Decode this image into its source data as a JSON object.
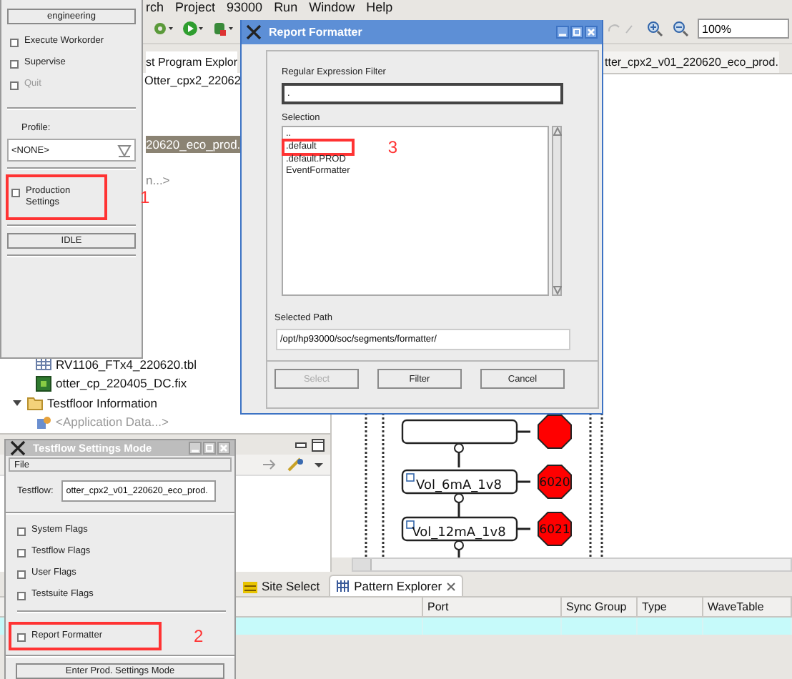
{
  "ide": {
    "menu": [
      "rch",
      "Project",
      "93000",
      "Run",
      "Window",
      "Help"
    ],
    "zoom_field": {
      "value": "100%"
    },
    "explorer": {
      "tab": {
        "label": "st Program Explor",
        "selected": true
      },
      "breadcrumb": "Otter_cpx2_22062",
      "partial_items": [
        {
          "label": "20620_eco_prod.",
          "selected": true
        },
        {
          "label": "n...>",
          "selected": false
        }
      ],
      "tree": [
        {
          "kind": "table",
          "label": "RV1106_FTx4_220620.tbl"
        },
        {
          "kind": "fix",
          "label": "otter_cp_220405_DC.fix"
        },
        {
          "kind": "folder",
          "label": "Testfloor Information",
          "expanded": true,
          "children": [
            {
              "kind": "data",
              "label": "<Application Data...>"
            }
          ]
        }
      ]
    },
    "editor": {
      "tab": {
        "label": "tter_cpx2_v01_220620_eco_prod.",
        "selected": true
      },
      "flow_nodes": [
        {
          "label": "Vol_6mA_1v8",
          "bin": "6020"
        },
        {
          "label": "Vol_12mA_1v8",
          "bin": "6021"
        }
      ]
    },
    "bottom_panel": {
      "tabs": [
        {
          "label": "Site Select",
          "selected": false
        },
        {
          "label": "Pattern Explorer",
          "selected": true
        }
      ],
      "table": {
        "columns": [
          "",
          "Port",
          "Sync Group",
          "Type",
          "WaveTable"
        ],
        "rows": [
          {
            "selected": true
          }
        ]
      }
    }
  },
  "engineering_panel": {
    "mode_button": "engineering",
    "options": [
      {
        "label": "Execute Workorder",
        "checked": false,
        "disabled": false
      },
      {
        "label": "Supervise",
        "checked": false,
        "disabled": false
      },
      {
        "label": "Quit",
        "checked": false,
        "disabled": true
      }
    ],
    "profile": {
      "label": "Profile:",
      "value": "<NONE>"
    },
    "production_settings": {
      "label": "Production Settings",
      "checked": false,
      "annotation": "1"
    },
    "status_button": "IDLE"
  },
  "report_formatter": {
    "title": "Report Formatter",
    "filter": {
      "label": "Regular Expression Filter",
      "value": "."
    },
    "selection": {
      "label": "Selection",
      "items": [
        {
          "label": "..",
          "selected": false
        },
        {
          "label": ".default",
          "selected": false,
          "annotation": "3"
        },
        {
          "label": ".default.PROD",
          "selected": false
        },
        {
          "label": "EventFormatter",
          "selected": false
        }
      ]
    },
    "selected_path": {
      "label": "Selected Path",
      "value": "/opt/hp93000/soc/segments/formatter/"
    },
    "buttons": [
      {
        "label": "Select",
        "disabled": true
      },
      {
        "label": "Filter",
        "disabled": false
      },
      {
        "label": "Cancel",
        "disabled": false
      }
    ]
  },
  "testflow_settings": {
    "title": "Testflow Settings Mode",
    "menu": [
      "File"
    ],
    "testflow": {
      "label": "Testflow:",
      "value": "otter_cpx2_v01_220620_eco_prod."
    },
    "flags": [
      {
        "label": "System Flags",
        "checked": false
      },
      {
        "label": "Testflow Flags",
        "checked": false
      },
      {
        "label": "User Flags",
        "checked": false
      },
      {
        "label": "Testsuite Flags",
        "checked": false
      },
      {
        "label": "Report Formatter",
        "checked": false,
        "annotation": "2"
      }
    ],
    "button": "Enter Prod. Settings Mode"
  }
}
